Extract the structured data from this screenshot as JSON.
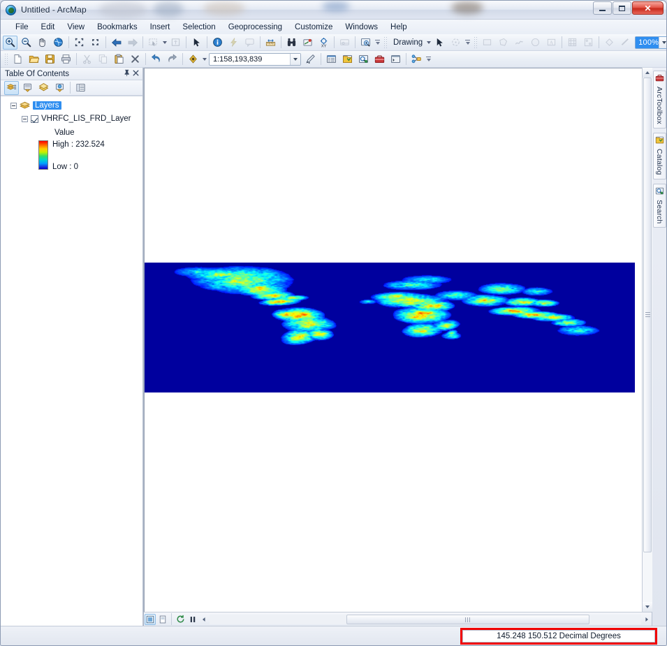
{
  "window": {
    "title": "Untitled - ArcMap",
    "app_icon": "arcmap-globe-icon",
    "controls": {
      "minimize": "–",
      "maximize": "▢",
      "close": "✕"
    }
  },
  "menubar": {
    "items": [
      {
        "label": "File"
      },
      {
        "label": "Edit"
      },
      {
        "label": "View"
      },
      {
        "label": "Bookmarks"
      },
      {
        "label": "Insert"
      },
      {
        "label": "Selection"
      },
      {
        "label": "Geoprocessing"
      },
      {
        "label": "Customize"
      },
      {
        "label": "Windows"
      },
      {
        "label": "Help"
      }
    ]
  },
  "tools_toolbar": {
    "buttons": [
      {
        "name": "zoom-in-icon",
        "state": "active"
      },
      {
        "name": "zoom-out-icon",
        "state": "normal"
      },
      {
        "name": "pan-hand-icon",
        "state": "normal"
      },
      {
        "name": "full-extent-globe-icon",
        "state": "normal"
      },
      {
        "name": "fixed-zoom-in-icon",
        "state": "normal"
      },
      {
        "name": "fixed-zoom-out-icon",
        "state": "normal"
      },
      {
        "name": "go-back-extent-icon",
        "state": "normal"
      },
      {
        "name": "go-forward-extent-icon",
        "state": "dim"
      },
      {
        "name": "select-features-icon",
        "state": "dim"
      },
      {
        "name": "clear-selection-icon",
        "state": "dim"
      },
      {
        "name": "select-elements-arrow-icon",
        "state": "normal"
      },
      {
        "name": "identify-info-icon",
        "state": "normal"
      },
      {
        "name": "hyperlink-lightning-icon",
        "state": "dim"
      },
      {
        "name": "html-popup-icon",
        "state": "dim"
      },
      {
        "name": "measure-icon",
        "state": "normal"
      },
      {
        "name": "find-binoculars-icon",
        "state": "normal"
      },
      {
        "name": "find-route-icon",
        "state": "normal"
      },
      {
        "name": "go-to-xy-icon",
        "state": "normal"
      },
      {
        "name": "time-slider-icon",
        "state": "dim"
      },
      {
        "name": "create-viewer-window-icon",
        "state": "normal"
      }
    ]
  },
  "draw_toolbar": {
    "label": "Drawing",
    "buttons": [
      {
        "name": "select-elements-arrow-icon"
      },
      {
        "name": "rotate-element-icon"
      }
    ],
    "more_buttons": [
      {
        "name": "new-rectangle-icon"
      },
      {
        "name": "new-polygon-icon"
      },
      {
        "name": "new-freehand-icon"
      },
      {
        "name": "new-circle-icon"
      },
      {
        "name": "new-text-icon"
      },
      {
        "name": "align-icon"
      },
      {
        "name": "distribute-icon"
      },
      {
        "name": "fill-color-icon"
      },
      {
        "name": "line-color-icon"
      }
    ],
    "font_size_value": "100%",
    "trailing_buttons": [
      {
        "name": "bold-icon"
      },
      {
        "name": "italic-icon"
      },
      {
        "name": "underline-icon"
      },
      {
        "name": "symbol-icon"
      }
    ]
  },
  "standard_toolbar": {
    "buttons": [
      {
        "name": "new-document-icon"
      },
      {
        "name": "open-folder-icon"
      },
      {
        "name": "save-icon"
      },
      {
        "name": "print-icon"
      },
      {
        "name": "cut-scissors-icon",
        "state": "dim"
      },
      {
        "name": "copy-icon",
        "state": "dim"
      },
      {
        "name": "paste-icon"
      },
      {
        "name": "delete-x-icon"
      },
      {
        "name": "undo-icon"
      },
      {
        "name": "redo-icon"
      },
      {
        "name": "add-data-icon"
      }
    ],
    "scale": {
      "label": "map-scale",
      "value": "1:158,193,839"
    },
    "after_scale_buttons": [
      {
        "name": "editor-toolbar-icon"
      },
      {
        "name": "table-of-contents-icon"
      },
      {
        "name": "catalog-window-icon"
      },
      {
        "name": "search-window-icon"
      },
      {
        "name": "arctoolbox-window-icon"
      },
      {
        "name": "python-window-icon"
      },
      {
        "name": "model-builder-icon"
      }
    ]
  },
  "toc": {
    "title": "Table Of Contents",
    "pin_icon": "pin-icon",
    "close_icon": "close-icon",
    "toolbar": [
      {
        "name": "list-by-drawing-order-icon",
        "state": "active"
      },
      {
        "name": "list-by-source-icon",
        "state": "normal"
      },
      {
        "name": "list-by-visibility-icon",
        "state": "normal"
      },
      {
        "name": "list-by-selection-icon",
        "state": "normal"
      },
      {
        "name": "toc-options-icon",
        "state": "normal"
      }
    ],
    "tree": {
      "root": {
        "label": "Layers",
        "selected": true
      },
      "layer": {
        "label": "VHRFC_LIS_FRD_Layer",
        "checked": true
      },
      "legend": {
        "title": "Value",
        "high_label": "High : 232.524",
        "low_label": "Low : 0",
        "ramp_colors": [
          "#ff0000",
          "#ff6a00",
          "#ffd000",
          "#c3f000",
          "#2fe06a",
          "#00d7c8",
          "#00a0ff",
          "#1a2fe0",
          "#0000cc"
        ]
      }
    }
  },
  "map": {
    "layer_name": "VHRFC_LIS_FRD_Layer",
    "background": "#ffffff",
    "raster_nodata_color": "#0010d8"
  },
  "map_status": {
    "buttons": [
      {
        "name": "data-view-icon",
        "state": "on"
      },
      {
        "name": "layout-view-icon",
        "state": "normal"
      },
      {
        "name": "refresh-view-icon",
        "state": "normal"
      },
      {
        "name": "pause-drawing-icon",
        "state": "normal"
      }
    ]
  },
  "right_dock": {
    "tabs": [
      {
        "label": "ArcToolbox",
        "icon": "arctoolbox-icon"
      },
      {
        "label": "Catalog",
        "icon": "catalog-icon"
      },
      {
        "label": "Search",
        "icon": "search-icon"
      }
    ]
  },
  "statusbar": {
    "coordinates": "145.248  150.512 Decimal Degrees",
    "highlight_color": "#f10000"
  }
}
